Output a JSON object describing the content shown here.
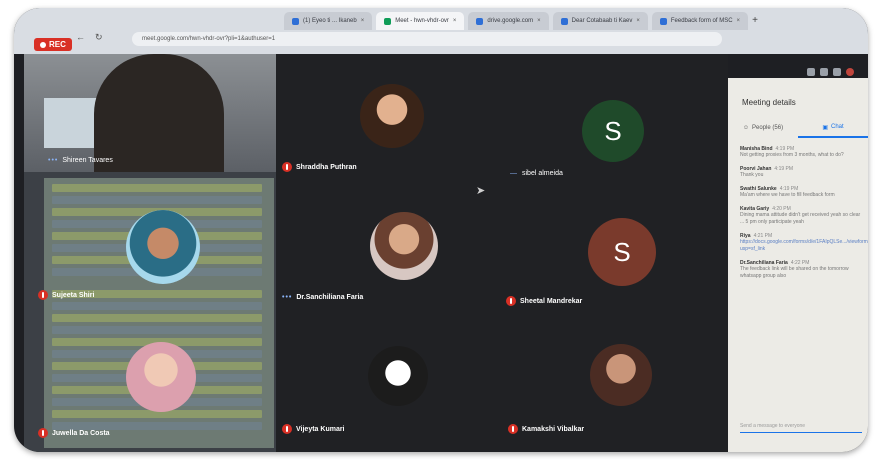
{
  "browser": {
    "url": "meet.google.com/hwn-vhdr-ovr?pli=1&authuser=1",
    "tabs": [
      {
        "title": "(1) Eyeo ti ... Ikaneb",
        "active": false
      },
      {
        "title": "Meet - hwn-vhdr-ovr",
        "active": true
      },
      {
        "title": "drive.google.com",
        "active": false
      },
      {
        "title": "Dear Cotabaab ti Kaev",
        "active": false
      },
      {
        "title": "Feedback form of MSC",
        "active": false
      }
    ],
    "new_tab": "+"
  },
  "recording": {
    "label": "REC"
  },
  "self_view": {
    "name": "Shireen Tavares"
  },
  "participants": [
    {
      "name": "Shraddha Puthran",
      "muted": true,
      "avatar": "photo"
    },
    {
      "name": "sibel almeida",
      "muted": false,
      "avatar": "letter",
      "letter": "S",
      "color": "#1f4a2a"
    },
    {
      "name": "Dr.Sanchiliana Faria",
      "muted": false,
      "avatar": "photo"
    },
    {
      "name": "Sheetal Mandrekar",
      "muted": true,
      "avatar": "letter",
      "letter": "S",
      "color": "#7a3a2c"
    },
    {
      "name": "Vijeyta Kumari",
      "muted": true,
      "avatar": "photo"
    },
    {
      "name": "Kamakshi Vibalkar",
      "muted": true,
      "avatar": "photo"
    },
    {
      "name": "Sujeeta Shiri",
      "muted": true,
      "avatar": "photo"
    },
    {
      "name": "Juwella Da Costa",
      "muted": true,
      "avatar": "photo"
    }
  ],
  "side_panel": {
    "title": "Meeting details",
    "tabs": [
      {
        "label": "People (56)",
        "icon": "people-icon",
        "active": false
      },
      {
        "label": "Chat",
        "icon": "chat-icon",
        "active": true
      }
    ],
    "messages": [
      {
        "sender": "Manisha Bind",
        "time": "4:19 PM",
        "text": "Not getting proxies from 3 months, what to do?",
        "link": false
      },
      {
        "sender": "Poorvi Jahan",
        "time": "4:19 PM",
        "text": "Thank you",
        "link": false
      },
      {
        "sender": "Swathi Salunke",
        "time": "4:19 PM",
        "text": "Ma'am where we have to fill feedback form",
        "link": false
      },
      {
        "sender": "Kavita Gariy",
        "time": "4:20 PM",
        "text": "Dining mama attitude didn't get received yeah so clear ... 5 pm only participate yeah",
        "link": false
      },
      {
        "sender": "Riya",
        "time": "4:21 PM",
        "text": "https://docs.google.com/forms/d/e/1FAIpQLSe.../viewform?usp=sf_link",
        "link": true
      },
      {
        "sender": "Dr.Sanchiliana Faria",
        "time": "4:22 PM",
        "text": "The feedback link will be shared on the tomorrow whatsapp group also",
        "link": false
      }
    ],
    "input_placeholder": "Send a message to everyone"
  },
  "colors": {
    "rec": "#d93025",
    "accent": "#1a73e8",
    "grid_bg": "#202124",
    "panel_bg": "#ecebe6"
  }
}
